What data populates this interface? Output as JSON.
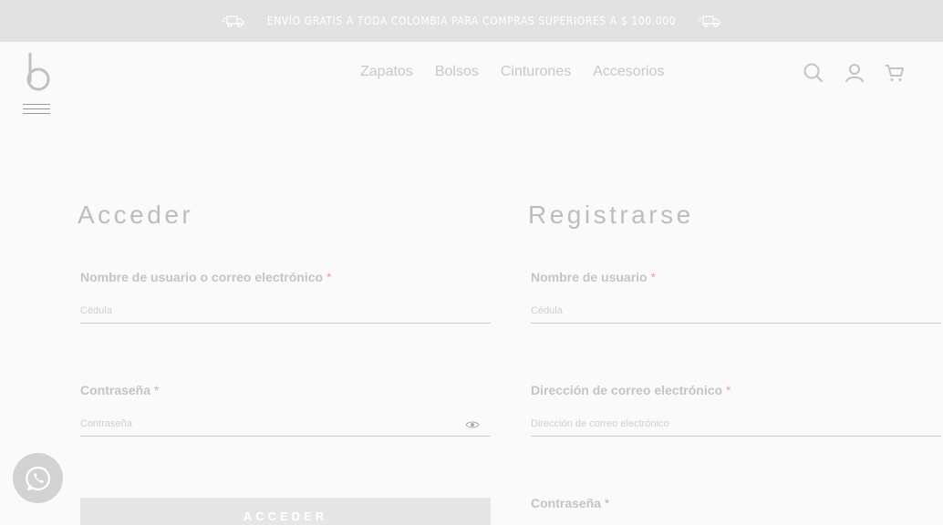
{
  "topbar": {
    "promo_text": "ENVÍO GRATIS A TODA COLOMBIA PARA COMPRAS SUPERIORES A $ 100.000",
    "icon_left": "delivery-truck-icon",
    "icon_right": "delivery-truck-icon"
  },
  "header": {
    "logo": "b",
    "nav": [
      {
        "label": "Zapatos"
      },
      {
        "label": "Bolsos"
      },
      {
        "label": "Cinturones"
      },
      {
        "label": "Accesorios"
      }
    ],
    "icons": [
      "search-icon",
      "user-icon",
      "cart-icon"
    ]
  },
  "login": {
    "title": "Acceder",
    "username": {
      "label": "Nombre de usuario o correo electrónico",
      "required_mark": "*",
      "placeholder": "Cédula"
    },
    "password": {
      "label": "Contraseña",
      "required_mark": "*",
      "placeholder": "Contraseña"
    },
    "submit_label": "ACCEDER"
  },
  "register": {
    "title": "Registrarse",
    "username": {
      "label": "Nombre de usuario",
      "required_mark": "*",
      "placeholder": "Cédula"
    },
    "email": {
      "label": "Dirección de correo electrónico",
      "required_mark": "*",
      "placeholder": "Dirección de correo electrónico"
    },
    "password": {
      "label": "Contraseña",
      "required_mark": "*"
    }
  },
  "colors": {
    "topbar_bg": "#e2e2e2",
    "page_bg": "#fafafa",
    "required": "#f0a0a0",
    "whatsapp_bg": "#d2d2d2"
  }
}
